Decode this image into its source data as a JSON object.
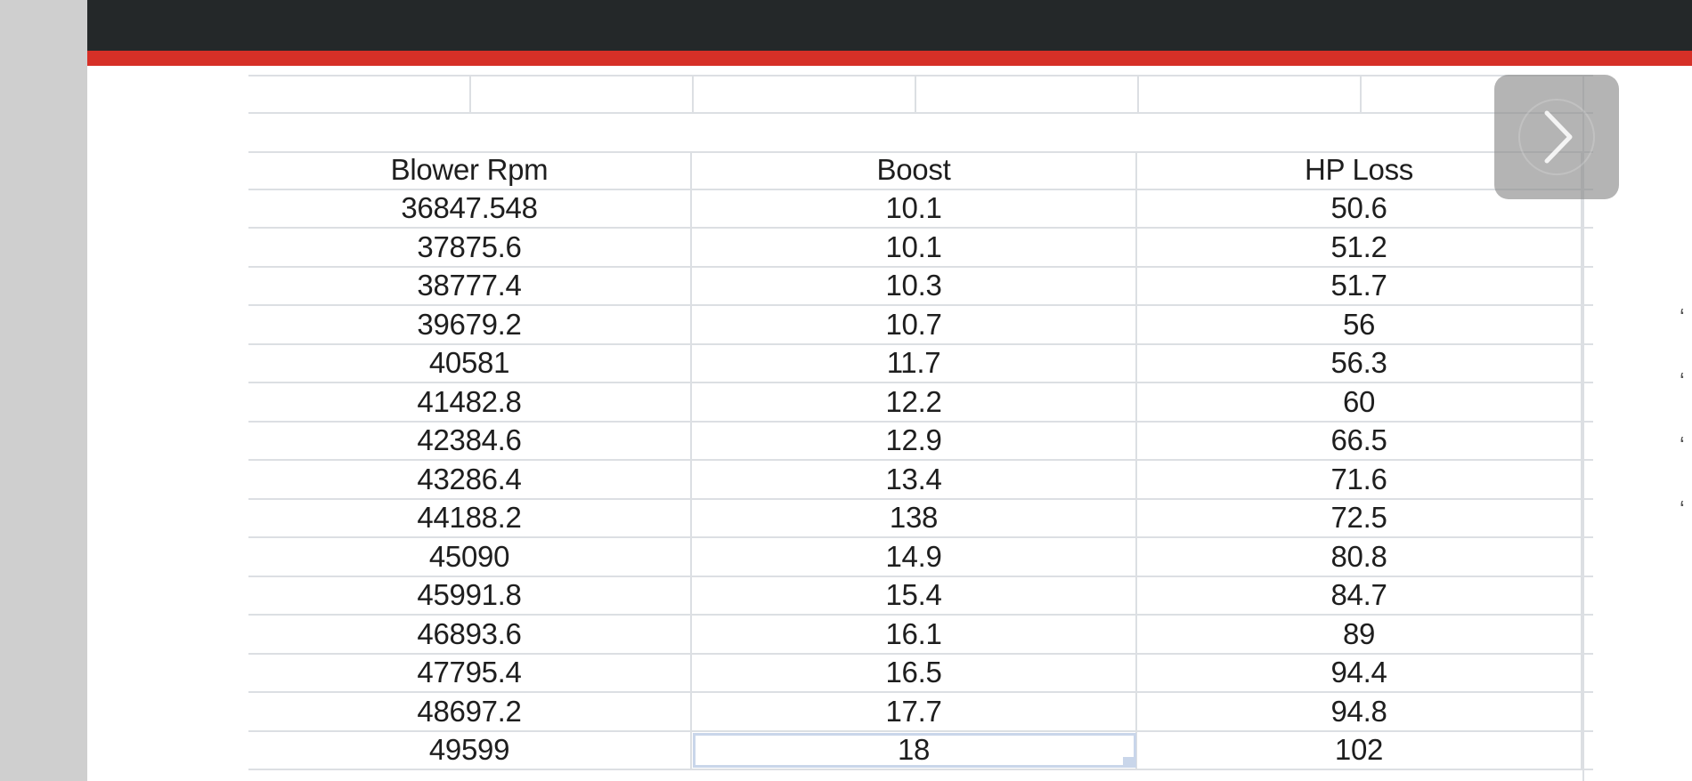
{
  "spreadsheet": {
    "columns": [
      "Blower Rpm",
      "Boost",
      "HP Loss"
    ],
    "rows": [
      [
        "36847.548",
        "10.1",
        "50.6"
      ],
      [
        "37875.6",
        "10.1",
        "51.2"
      ],
      [
        "38777.4",
        "10.3",
        "51.7"
      ],
      [
        "39679.2",
        "10.7",
        "56"
      ],
      [
        "40581",
        "11.7",
        "56.3"
      ],
      [
        "41482.8",
        "12.2",
        "60"
      ],
      [
        "42384.6",
        "12.9",
        "66.5"
      ],
      [
        "43286.4",
        "13.4",
        "71.6"
      ],
      [
        "44188.2",
        "138",
        "72.5"
      ],
      [
        "45090",
        "14.9",
        "80.8"
      ],
      [
        "45991.8",
        "15.4",
        "84.7"
      ],
      [
        "46893.6",
        "16.1",
        "89"
      ],
      [
        "47795.4",
        "16.5",
        "94.4"
      ],
      [
        "48697.2",
        "17.7",
        "94.8"
      ],
      [
        "49599",
        "18",
        "102"
      ]
    ],
    "selected_cell": {
      "row": 14,
      "column": "Boost"
    }
  },
  "controls": {
    "next_icon": "chevron-right-icon"
  },
  "colors": {
    "top_bar": "#242829",
    "accent_bar": "#d63027",
    "gutter": "#cfcfcf",
    "grid": "#dcdfe3",
    "selection": "#c9d6ea"
  }
}
